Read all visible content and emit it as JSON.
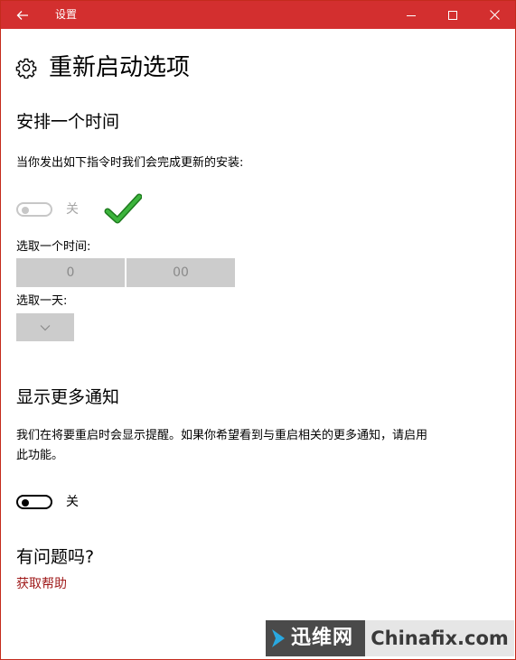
{
  "titlebar": {
    "title": "设置",
    "back_icon": "arrow-left-icon",
    "minimize_icon": "minimize-icon",
    "maximize_icon": "maximize-icon",
    "close_icon": "close-icon",
    "color": "#d32f2f"
  },
  "header": {
    "icon": "gear-icon",
    "title": "重新启动选项"
  },
  "schedule": {
    "heading": "安排一个时间",
    "description": "当你发出如下指令时我们会完成更新的安装:",
    "toggle_state_label": "关",
    "toggle_on": false,
    "toggle_enabled": false,
    "time_label": "选取一个时间:",
    "hour_value": "0",
    "minute_value": "00",
    "day_label": "选取一天:",
    "day_value": "",
    "day_dropdown_icon": "chevron-down-icon",
    "annotation_icon": "green-checkmark-icon"
  },
  "notifications": {
    "heading": "显示更多通知",
    "description_line1": "我们在将要重启时会显示提醒。如果你希望看到与重启相关的更多通知，请启用",
    "description_line2": "此功能。",
    "toggle_state_label": "关",
    "toggle_on": false
  },
  "help": {
    "heading": "有问题吗?",
    "link_label": "获取帮助",
    "link_color": "#a01c1c"
  },
  "watermark": {
    "cn_text": "迅维网",
    "en_text": "Chinafix.com",
    "arrow_color": "#29a8e0"
  }
}
